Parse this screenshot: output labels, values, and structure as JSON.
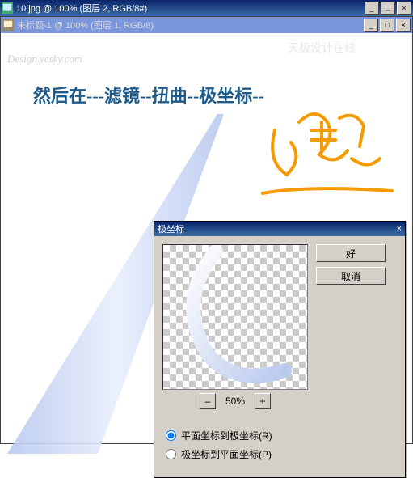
{
  "outer_window": {
    "title": "10.jpg @ 100% (图层 2, RGB/8#)"
  },
  "inner_window": {
    "title": "未标题-1 @ 100% (图层 1, RGB/8)"
  },
  "watermark": {
    "line1": "Design.yesky.com",
    "badge": "天极设计在线"
  },
  "annotation": "然后在---滤镜--扭曲--极坐标--",
  "dialog": {
    "title": "极坐标",
    "ok": "好",
    "cancel": "取消",
    "zoom_minus": "–",
    "zoom_plus": "+",
    "zoom_pct": "50%",
    "radio1": "平面坐标到极坐标(R)",
    "radio2": "极坐标到平面坐标(P)"
  },
  "winctrl": {
    "min": "_",
    "max": "□",
    "close": "×"
  }
}
